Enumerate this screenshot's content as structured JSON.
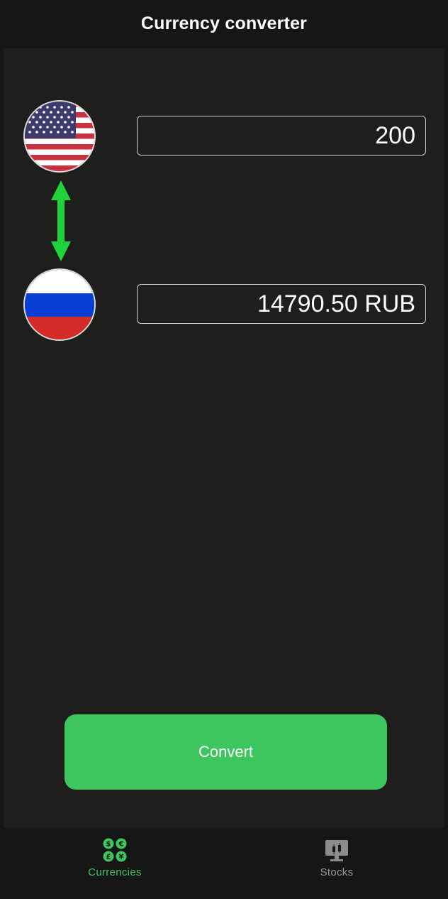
{
  "nav": {
    "title": "Currency converter"
  },
  "converter": {
    "from": {
      "flag": "us-flag-icon",
      "value": "200"
    },
    "to": {
      "flag": "ru-flag-icon",
      "value": "14790.50 RUB"
    },
    "swap_icon": "swap-vertical-icon"
  },
  "actions": {
    "convert_label": "Convert"
  },
  "tabs": [
    {
      "label": "Currencies",
      "icon": "currencies-icon",
      "active": true
    },
    {
      "label": "Stocks",
      "icon": "stocks-icon",
      "active": false
    }
  ],
  "colors": {
    "background": "#1e1e1c",
    "bar": "#161616",
    "accent": "#3dc55e",
    "arrow": "#21d33a",
    "inactive_tab": "#9a9a9a"
  }
}
